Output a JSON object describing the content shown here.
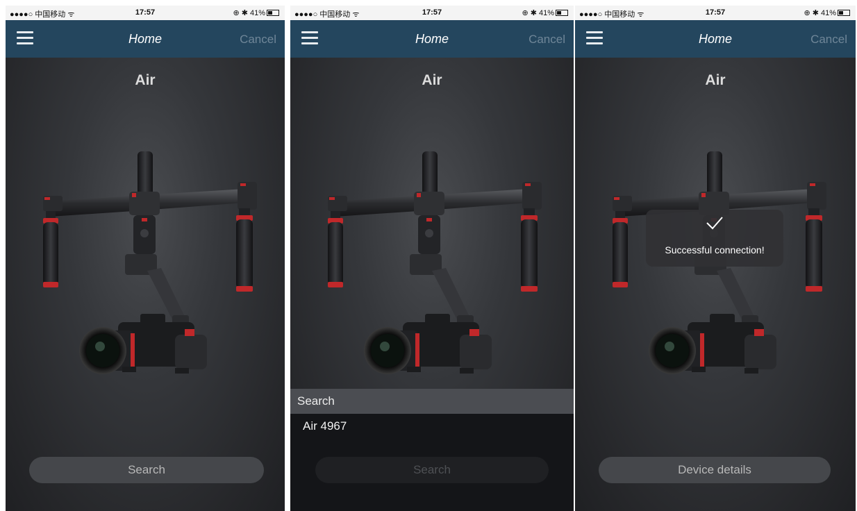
{
  "screens": [
    {
      "status": {
        "carrier": "●●●●○ 中国移动 ᯤ",
        "time": "17:57",
        "right": "⊕ ✱ 41%"
      },
      "nav": {
        "title": "Home",
        "cancel": "Cancel"
      },
      "device_name": "Air",
      "button": "Search"
    },
    {
      "status": {
        "carrier": "●●●●○ 中国移动 ᯤ",
        "time": "17:57",
        "right": "⊕ ✱ 41%"
      },
      "nav": {
        "title": "Home",
        "cancel": "Cancel"
      },
      "device_name": "Air",
      "search": {
        "header": "Search",
        "results": [
          "Air 4967"
        ]
      },
      "button": "Search"
    },
    {
      "status": {
        "carrier": "●●●●○ 中国移动 ᯤ",
        "time": "17:57",
        "right": "⊕ ✱ 41%"
      },
      "nav": {
        "title": "Home",
        "cancel": "Cancel"
      },
      "device_name": "Air",
      "toast": "Successful connection!",
      "button": "Device details"
    }
  ],
  "colors": {
    "navbar": "#24465e",
    "cancel": "#6f8698",
    "accent_red": "#c0282a",
    "button_bg": "#45474b"
  },
  "icons": [
    "menu-icon",
    "signal-icon",
    "wifi-icon",
    "bluetooth-icon",
    "battery-icon",
    "check-icon"
  ]
}
